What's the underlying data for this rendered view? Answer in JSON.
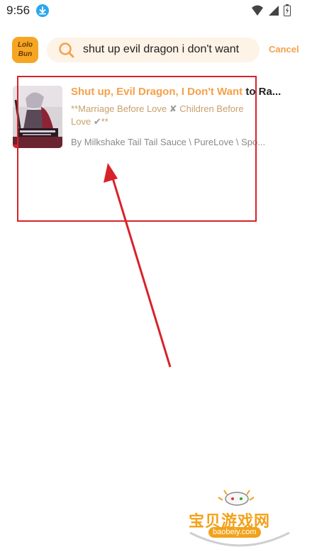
{
  "status_bar": {
    "time": "9:56",
    "icons": [
      "download-icon",
      "wifi-icon",
      "signal-icon",
      "battery-icon"
    ]
  },
  "app": {
    "logo_text_line1": "Lolo",
    "logo_text_line2": "Bun"
  },
  "search": {
    "query": "shut up evil dragon i don't want",
    "cancel_label": "Cancel"
  },
  "results": [
    {
      "title_highlight": "Shut up, Evil Dragon, I Don't Want",
      "title_rest": " to Ra...",
      "desc_line1_a": "**Marriage Before Love ",
      "desc_mark1": "✘",
      "desc_line1_b": "   Children Before",
      "desc_line2_a": "Love ",
      "desc_mark2": "✔",
      "desc_line2_b": "**",
      "author": "By Milkshake Tail Tail Sauce \\ PureLove \\ Spo..."
    }
  ],
  "watermark": {
    "text": "宝贝游戏网",
    "url": "baobeiy.com"
  },
  "colors": {
    "accent": "#f5a04a",
    "annotation_red": "#d8222a",
    "search_bg": "#fdf3e6"
  }
}
